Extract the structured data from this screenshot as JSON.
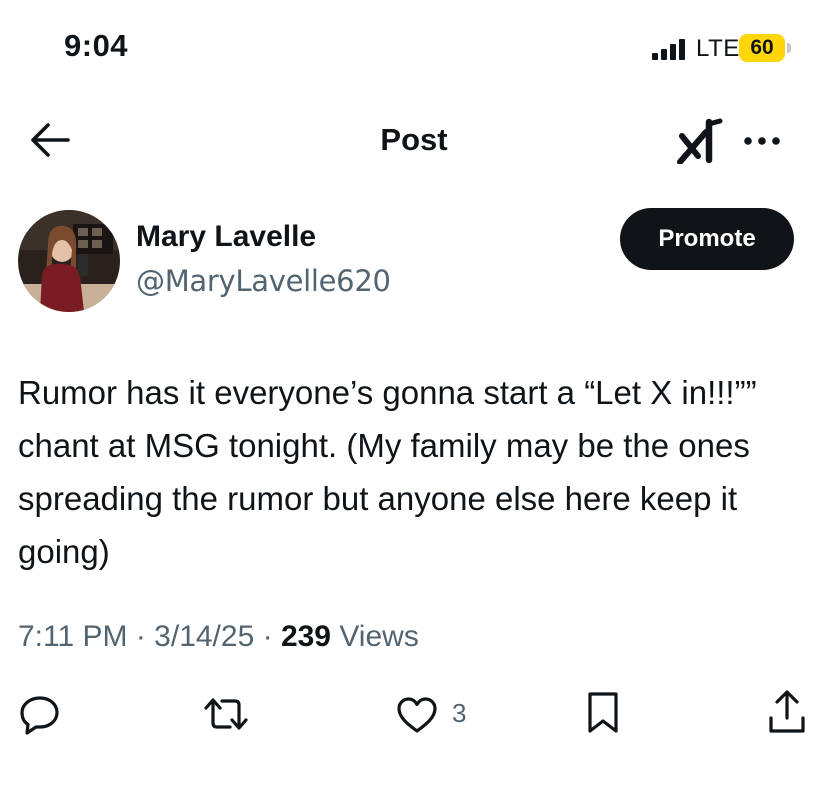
{
  "status_bar": {
    "time": "9:04",
    "network": "LTE",
    "battery": "60",
    "battery_color": "#ffd60a",
    "signal_icon": "cellular-signal-icon"
  },
  "nav": {
    "title": "Post",
    "back_icon": "back-arrow-icon",
    "grok_icon": "grok-icon",
    "more_icon": "more-options-icon"
  },
  "author": {
    "name": "Mary Lavelle",
    "handle": "@MaryLavelle620"
  },
  "promote_label": "Promote",
  "post": {
    "text": "Rumor has it everyone’s gonna start a “Let X in!!!”” chant at MSG tonight. (My family may be the ones spreading the rumor but anyone else here keep it going)"
  },
  "meta": {
    "time": "7:11 PM",
    "sep1": " · ",
    "date": "3/14/25",
    "sep2": " · ",
    "views_count": "239",
    "views_label": " Views"
  },
  "actions": {
    "reply_icon": "reply-icon",
    "repost_icon": "repost-icon",
    "like_icon": "heart-icon",
    "like_count": "3",
    "bookmark_icon": "bookmark-icon",
    "share_icon": "share-icon"
  },
  "colors": {
    "text_primary": "#0f1419",
    "text_secondary": "#536471",
    "button_dark": "#0f1419"
  }
}
